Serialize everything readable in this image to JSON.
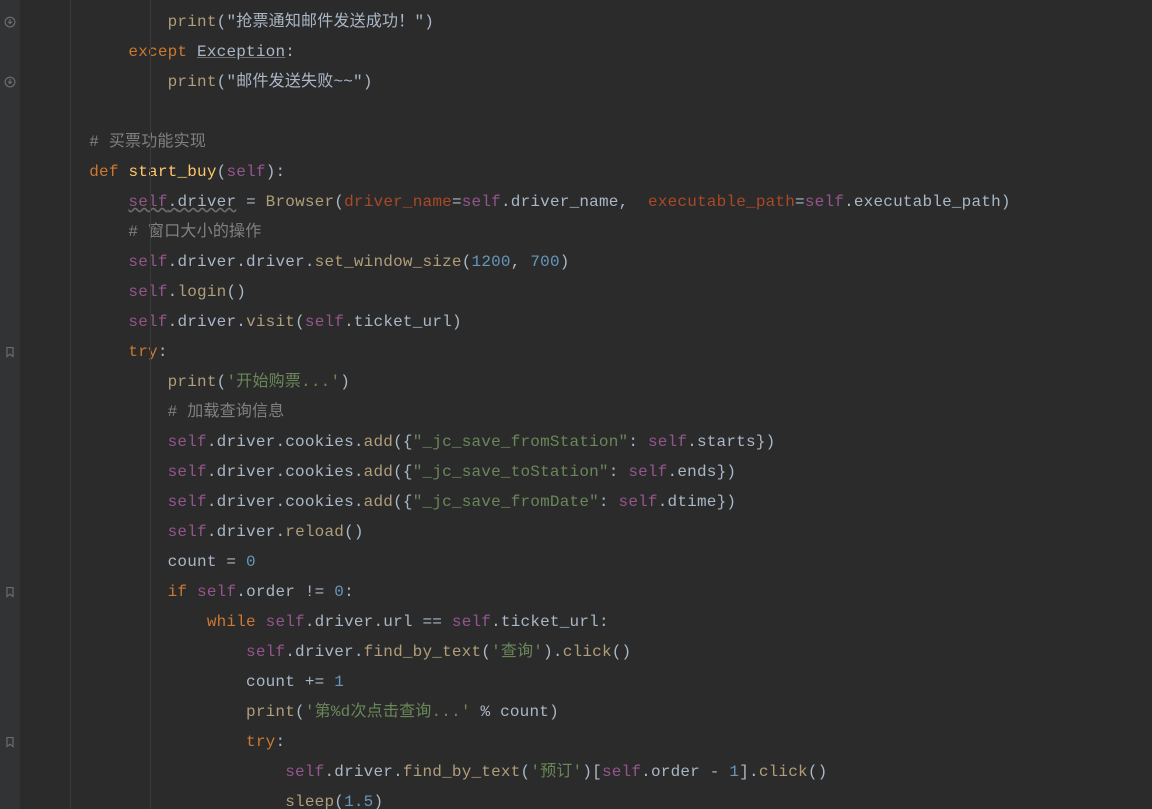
{
  "code": {
    "l1": {
      "print": "print",
      "s": "(\"抢票通知邮件发送成功！\")"
    },
    "l2": {
      "except": "except",
      "ex": "Exception",
      "colon": ":"
    },
    "l3": {
      "print": "print",
      "s": "(\"邮件发送失败~~\")"
    },
    "l5": {
      "c": "# 买票功能实现"
    },
    "l6": {
      "def": "def",
      "fn": "start_buy",
      "lp": "(",
      "self": "self",
      "rp": "):"
    },
    "l7": {
      "self": "self",
      "dot1": ".",
      "driver": "driver",
      "eq": " = ",
      "Browser": "Browser",
      "lp": "(",
      "kwarg1": "driver_name",
      "eq1": "=",
      "self1": "self",
      "m1": ".driver_name",
      "comma1": ",  ",
      "kwarg2": "executable_path",
      "eq2": "=",
      "self2": "self",
      "m2": ".executable_path",
      "rp": ")"
    },
    "l8": {
      "c": "# 窗口大小的操作"
    },
    "l9": {
      "self": "self",
      "m": ".driver.driver.",
      "fn": "set_window_size",
      "lp": "(",
      "n1": "1200",
      "comma": ", ",
      "n2": "700",
      "rp": ")"
    },
    "l10": {
      "self": "self",
      "m": ".",
      "fn": "login",
      "p": "()"
    },
    "l11": {
      "self": "self",
      "m": ".driver.",
      "fn": "visit",
      "lp": "(",
      "self1": "self",
      "m1": ".ticket_url",
      "rp": ")"
    },
    "l12": {
      "try": "try",
      "colon": ":"
    },
    "l13": {
      "print": "print",
      "lp": "(",
      "s": "'开始购票...'",
      "rp": ")"
    },
    "l14": {
      "c": "# 加载查询信息"
    },
    "l15": {
      "self": "self",
      "m": ".driver.cookies.",
      "fn": "add",
      "lp": "({",
      "s": "\"_jc_save_fromStation\"",
      "colon": ": ",
      "self1": "self",
      "m1": ".starts",
      "rp": "})"
    },
    "l16": {
      "self": "self",
      "m": ".driver.cookies.",
      "fn": "add",
      "lp": "({",
      "s": "\"_jc_save_toStation\"",
      "colon": ": ",
      "self1": "self",
      "m1": ".ends",
      "rp": "})"
    },
    "l17": {
      "self": "self",
      "m": ".driver.cookies.",
      "fn": "add",
      "lp": "({",
      "s": "\"_jc_save_fromDate\"",
      "colon": ": ",
      "self1": "self",
      "m1": ".dtime",
      "rp": "})"
    },
    "l18": {
      "self": "self",
      "m": ".driver.",
      "fn": "reload",
      "p": "()"
    },
    "l19": {
      "v": "count = ",
      "n": "0"
    },
    "l20": {
      "if": "if",
      "sp": " ",
      "self": "self",
      "m": ".order != ",
      "n": "0",
      "colon": ":"
    },
    "l21": {
      "while": "while",
      "sp": " ",
      "self": "self",
      "m": ".driver.url == ",
      "self1": "self",
      "m1": ".ticket_url:",
      "colon": ""
    },
    "l22": {
      "self": "self",
      "m": ".driver.",
      "fn": "find_by_text",
      "lp": "(",
      "s": "'查询'",
      "rp": ").",
      "fn2": "click",
      "p2": "()"
    },
    "l23": {
      "v": "count += ",
      "n": "1"
    },
    "l24": {
      "print": "print",
      "lp": "(",
      "s": "'第%d次点击查询...'",
      "pct": " % count",
      "rp": ")"
    },
    "l25": {
      "try": "try",
      "colon": ":"
    },
    "l26": {
      "self": "self",
      "m": ".driver.",
      "fn": "find_by_text",
      "lp": "(",
      "s": "'预订'",
      "rp": ")[",
      "self1": "self",
      "m1": ".order - ",
      "n": "1",
      "rb": "].",
      "fn2": "click",
      "p2": "()"
    },
    "l27": {
      "fn": "sleep",
      "lp": "(",
      "n": "1.5",
      "rp": ")"
    }
  }
}
